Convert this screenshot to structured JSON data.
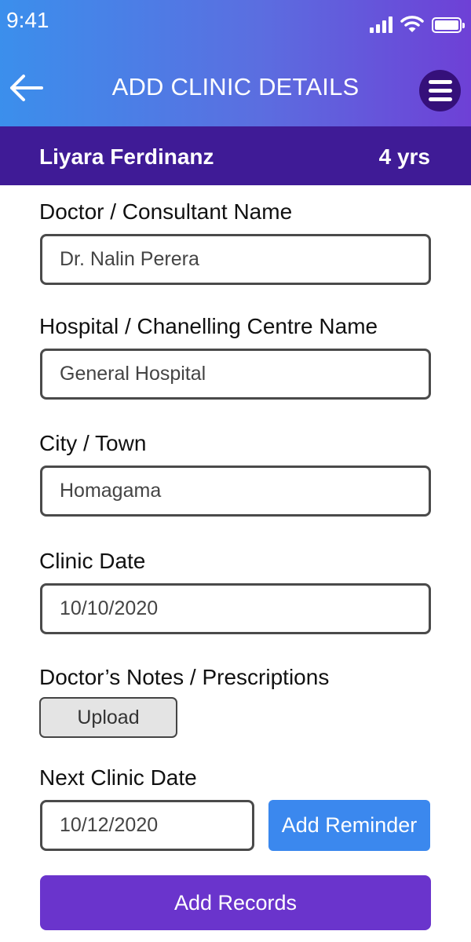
{
  "status_bar": {
    "time": "9:41",
    "icons": [
      "signal-icon",
      "wifi-icon",
      "battery-icon"
    ]
  },
  "header": {
    "title": "ADD CLINIC DETAILS",
    "back_icon": "arrow-left-icon",
    "menu_icon": "hamburger-menu-icon",
    "gradient_colors": [
      "#3b8fec",
      "#6e40d6"
    ]
  },
  "patient": {
    "name": "Liyara Ferdinanz",
    "age": "4 yrs",
    "bar_color": "#3f1b96"
  },
  "form": {
    "doctor": {
      "label": "Doctor / Consultant Name",
      "value": "Dr. Nalin Perera"
    },
    "hospital": {
      "label": "Hospital / Chanelling Centre Name",
      "value": "General Hospital"
    },
    "city": {
      "label": "City / Town",
      "value": "Homagama"
    },
    "clinic_date": {
      "label": "Clinic Date",
      "value": "10/10/2020"
    },
    "notes": {
      "label": "Doctor’s Notes / Prescriptions",
      "upload_label": "Upload"
    },
    "next_clinic_date": {
      "label": "Next Clinic Date",
      "value": "10/12/2020",
      "reminder_label": "Add Reminder"
    },
    "submit_label": "Add Records"
  },
  "colors": {
    "reminder_button": "#3b88ee",
    "submit_button": "#6a34cc"
  }
}
